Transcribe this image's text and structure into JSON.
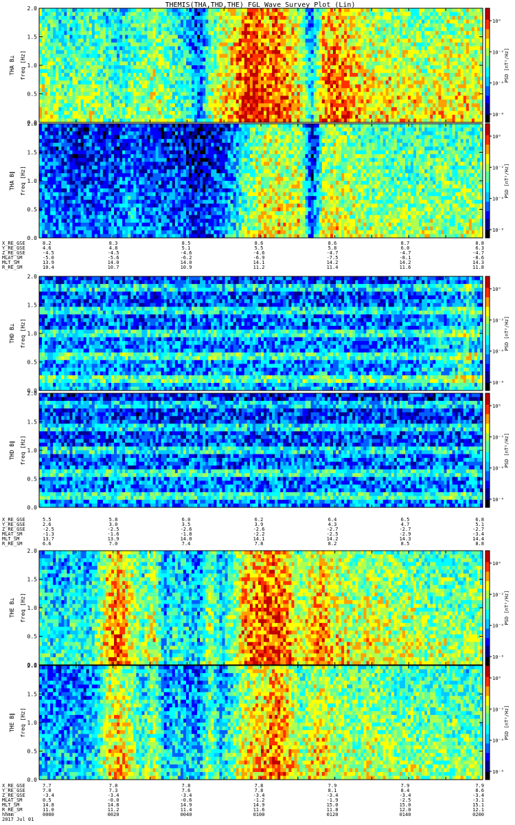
{
  "title": "THEMIS(THA,THD,THE) FGL Wave Survey Plot (Lin)",
  "colors": {
    "jet": [
      "#000000",
      "#00008f",
      "#0000ff",
      "#0060ff",
      "#00c8ff",
      "#00ffff",
      "#60ff9f",
      "#b0ff50",
      "#ffff00",
      "#ffa000",
      "#ff3000",
      "#c00000"
    ]
  },
  "chart_data": [
    {
      "type": "heatmap",
      "group": "THA",
      "ylabel": "THA B⊥",
      "yunit": "freq [Hz]",
      "ylim": [
        0.0,
        2.0
      ],
      "yticks": [
        "0.0",
        "0.5",
        "1.0",
        "1.5",
        "2.0"
      ],
      "colorbar_label": "PSD [nT²/Hz]",
      "colorbar_ticks": [
        "10⁻⁸",
        "10⁻⁴",
        "10⁻²",
        "10⁰"
      ],
      "profile": [
        0.55,
        0.5,
        0.45,
        0.45,
        0.5,
        0.5,
        0.45,
        0.4,
        0.5,
        0.5,
        0.55,
        0.5,
        0.45,
        0.4,
        0.2,
        0.5,
        0.6,
        0.65,
        0.8,
        0.85,
        0.75,
        0.8,
        0.7,
        0.6,
        0.3,
        0.7,
        0.75,
        0.7,
        0.65,
        0.6,
        0.6,
        0.6,
        0.6,
        0.6,
        0.55,
        0.6,
        0.6,
        0.6,
        0.6,
        0.6
      ]
    },
    {
      "type": "heatmap",
      "group": "THA",
      "ylabel": "THA B∥",
      "yunit": "freq [Hz]",
      "ylim": [
        0.0,
        2.0
      ],
      "yticks": [
        "0.0",
        "0.5",
        "1.0",
        "1.5",
        "2.0"
      ],
      "colorbar_label": "PSD [nT²/Hz]",
      "colorbar_ticks": [
        "10⁻⁶",
        "10⁻⁴",
        "10⁻²",
        "10⁰"
      ],
      "profile": [
        0.25,
        0.22,
        0.2,
        0.2,
        0.2,
        0.22,
        0.2,
        0.2,
        0.3,
        0.2,
        0.2,
        0.2,
        0.18,
        0.18,
        0.12,
        0.15,
        0.2,
        0.3,
        0.45,
        0.55,
        0.6,
        0.6,
        0.55,
        0.6,
        0.15,
        0.55,
        0.6,
        0.55,
        0.55,
        0.5,
        0.5,
        0.5,
        0.5,
        0.5,
        0.5,
        0.5,
        0.5,
        0.5,
        0.5,
        0.5
      ]
    },
    {
      "type": "heatmap",
      "group": "THD",
      "ylabel": "THD B⊥",
      "yunit": "freq [Hz]",
      "ylim": [
        0.0,
        2.0
      ],
      "yticks": [
        "0.0",
        "0.5",
        "1.0",
        "1.5",
        "2.0"
      ],
      "colorbar_label": "PSD [nT²/Hz]",
      "colorbar_ticks": [
        "10⁻⁶",
        "10⁻⁴",
        "10⁻²",
        "10⁰"
      ],
      "profile": [
        0.25,
        0.25,
        0.25,
        0.25,
        0.25,
        0.25,
        0.25,
        0.25,
        0.25,
        0.25,
        0.25,
        0.25,
        0.25,
        0.25,
        0.25,
        0.25,
        0.25,
        0.25,
        0.25,
        0.25,
        0.25,
        0.25,
        0.25,
        0.25,
        0.25,
        0.25,
        0.25,
        0.25,
        0.25,
        0.25,
        0.25,
        0.25,
        0.25,
        0.25,
        0.28,
        0.3,
        0.3,
        0.35,
        0.4,
        0.3
      ]
    },
    {
      "type": "heatmap",
      "group": "THD",
      "ylabel": "THD B∥",
      "yunit": "freq [Hz]",
      "ylim": [
        0.0,
        2.0
      ],
      "yticks": [
        "0.0",
        "0.5",
        "1.0",
        "1.5",
        "2.0"
      ],
      "colorbar_label": "PSD [nT²/Hz]",
      "colorbar_ticks": [
        "10⁻⁶",
        "10⁻⁴",
        "10⁻²",
        "10⁰"
      ],
      "profile": [
        0.22,
        0.22,
        0.22,
        0.22,
        0.22,
        0.22,
        0.22,
        0.22,
        0.22,
        0.22,
        0.22,
        0.22,
        0.22,
        0.22,
        0.22,
        0.22,
        0.22,
        0.22,
        0.22,
        0.22,
        0.22,
        0.22,
        0.22,
        0.22,
        0.22,
        0.22,
        0.22,
        0.22,
        0.22,
        0.22,
        0.22,
        0.22,
        0.22,
        0.22,
        0.22,
        0.22,
        0.22,
        0.22,
        0.25,
        0.2
      ]
    },
    {
      "type": "heatmap",
      "group": "THE",
      "ylabel": "THE B⊥",
      "yunit": "freq [Hz]",
      "ylim": [
        0.0,
        2.0
      ],
      "yticks": [
        "0.0",
        "0.5",
        "1.0",
        "1.5",
        "2.0"
      ],
      "colorbar_label": "PSD [nT²/Hz]",
      "colorbar_ticks": [
        "10⁻⁶",
        "10⁻⁴",
        "10⁻²",
        "10⁰"
      ],
      "profile": [
        0.4,
        0.35,
        0.35,
        0.4,
        0.35,
        0.45,
        0.7,
        0.75,
        0.6,
        0.45,
        0.6,
        0.3,
        0.4,
        0.35,
        0.3,
        0.55,
        0.35,
        0.5,
        0.7,
        0.75,
        0.78,
        0.8,
        0.7,
        0.55,
        0.65,
        0.7,
        0.6,
        0.6,
        0.55,
        0.6,
        0.58,
        0.55,
        0.55,
        0.55,
        0.5,
        0.5,
        0.52,
        0.5,
        0.5,
        0.5
      ]
    },
    {
      "type": "heatmap",
      "group": "THE",
      "ylabel": "THE B∥",
      "yunit": "freq [Hz]",
      "ylim": [
        0.0,
        2.0
      ],
      "yticks": [
        "0.0",
        "0.5",
        "1.0",
        "1.5",
        "2.0"
      ],
      "colorbar_label": "PSD [nT²/Hz]",
      "colorbar_ticks": [
        "10⁻⁶",
        "10⁻⁴",
        "10⁻²",
        "10⁰"
      ],
      "profile": [
        0.3,
        0.28,
        0.28,
        0.3,
        0.28,
        0.35,
        0.6,
        0.65,
        0.55,
        0.4,
        0.55,
        0.28,
        0.35,
        0.3,
        0.28,
        0.5,
        0.3,
        0.45,
        0.6,
        0.65,
        0.7,
        0.75,
        0.65,
        0.5,
        0.6,
        0.62,
        0.55,
        0.55,
        0.5,
        0.55,
        0.52,
        0.5,
        0.5,
        0.5,
        0.48,
        0.48,
        0.48,
        0.48,
        0.48,
        0.48
      ]
    }
  ],
  "ephemeris": [
    {
      "rows": [
        {
          "label": "X_RE_GSE",
          "values": [
            "8.2",
            "8.3",
            "8.5",
            "8.6",
            "8.6",
            "8.7",
            "8.8"
          ]
        },
        {
          "label": "Y_RE_GSE",
          "values": [
            "4.6",
            "4.8",
            "5.1",
            "5.5",
            "5.8",
            "6.0",
            "6.3"
          ]
        },
        {
          "label": "Z_RE_GSE",
          "values": [
            "-4.5",
            "-4.5",
            "-4.6",
            "-4.6",
            "-4.7",
            "-4.7",
            "-4.7"
          ]
        },
        {
          "label": "MLAT_SM",
          "values": [
            "-5.0",
            "-5.6",
            "-6.2",
            "-6.9",
            "-7.5",
            "-8.1",
            "-8.6"
          ]
        },
        {
          "label": "MLT_SM",
          "values": [
            "13.9",
            "14.0",
            "14.0",
            "14.1",
            "14.2",
            "14.2",
            "14.3"
          ]
        },
        {
          "label": "R_RE_SM",
          "values": [
            "10.4",
            "10.7",
            "10.9",
            "11.2",
            "11.4",
            "11.6",
            "11.8"
          ]
        }
      ]
    },
    {
      "rows": [
        {
          "label": "X_RE_GSE",
          "values": [
            "5.5",
            "5.8",
            "6.0",
            "6.2",
            "6.4",
            "6.5",
            "6.8"
          ]
        },
        {
          "label": "Y_RE_GSE",
          "values": [
            "2.6",
            "3.0",
            "3.5",
            "3.9",
            "4.3",
            "4.7",
            "5.1"
          ]
        },
        {
          "label": "Z_RE_GSE",
          "values": [
            "-2.5",
            "-2.5",
            "-2.6",
            "-2.6",
            "-2.7",
            "-2.7",
            "-2.7"
          ]
        },
        {
          "label": "MLAT_SM",
          "values": [
            "-1.3",
            "-1.6",
            "-1.8",
            "-2.2",
            "-2.5",
            "-2.9",
            "-3.4"
          ]
        },
        {
          "label": "MLT_SM",
          "values": [
            "13.7",
            "13.9",
            "14.0",
            "14.1",
            "14.2",
            "14.3",
            "14.4"
          ]
        },
        {
          "label": "R_RE_SM",
          "values": [
            "6.6",
            "7.0",
            "7.4",
            "7.8",
            "8.2",
            "8.5",
            "8.8"
          ]
        }
      ]
    },
    {
      "rows": [
        {
          "label": "X_RE_GSE",
          "values": [
            "7.7",
            "7.8",
            "7.8",
            "7.8",
            "7.9",
            "7.9",
            "7.9"
          ]
        },
        {
          "label": "Y_RE_GSE",
          "values": [
            "7.0",
            "7.3",
            "7.6",
            "7.8",
            "8.1",
            "8.4",
            "8.6"
          ]
        },
        {
          "label": "Z_RE_GSE",
          "values": [
            "-3.4",
            "-3.4",
            "-3.4",
            "-3.4",
            "-3.4",
            "-3.4",
            "-3.4"
          ]
        },
        {
          "label": "MLAT_SM",
          "values": [
            "0.5",
            "-0.0",
            "-0.6",
            "-1.2",
            "-1.9",
            "-2.5",
            "-3.1"
          ]
        },
        {
          "label": "MLT_SM",
          "values": [
            "14.8",
            "14.8",
            "14.9",
            "14.9",
            "15.0",
            "15.0",
            "15.1"
          ]
        },
        {
          "label": "R_RE_SM",
          "values": [
            "11.0",
            "11.2",
            "11.4",
            "11.6",
            "11.8",
            "12.0",
            "12.1"
          ]
        },
        {
          "label": "hhmm",
          "values": [
            "0000",
            "0020",
            "0040",
            "0100",
            "0120",
            "0140",
            "0200"
          ]
        }
      ],
      "date_label": "2017 Jul 01"
    }
  ]
}
